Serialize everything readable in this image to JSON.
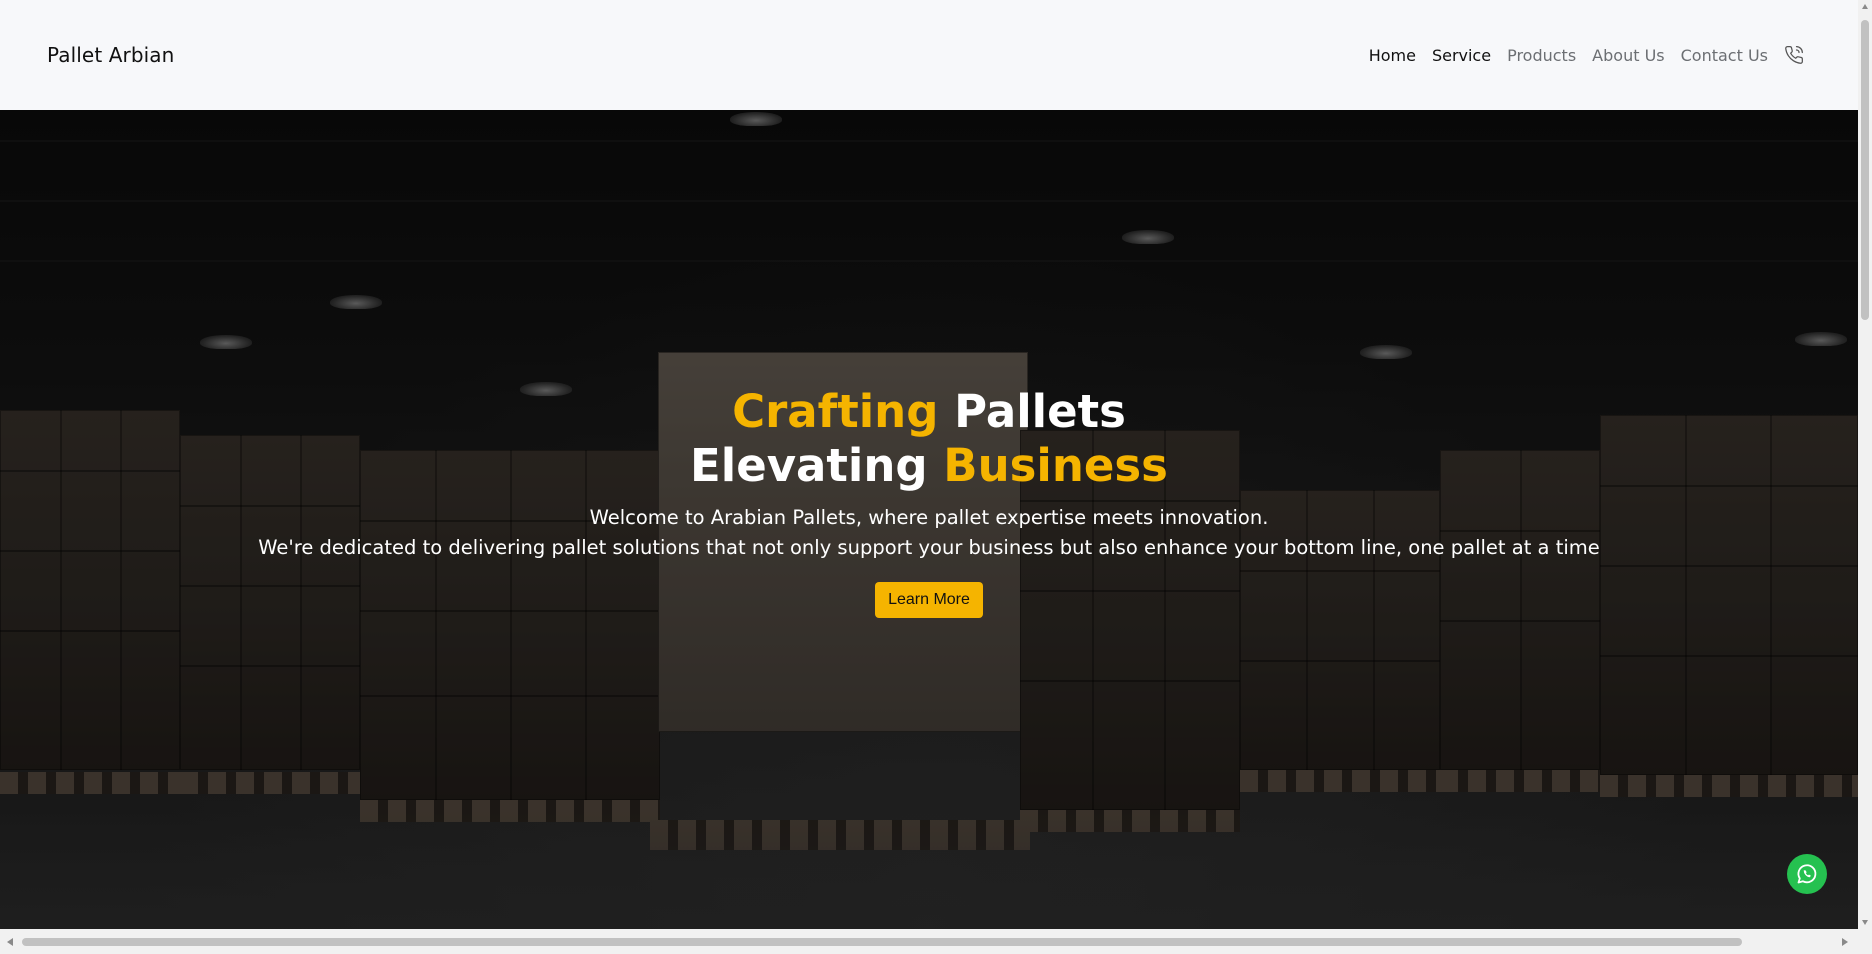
{
  "header": {
    "brand": "Pallet Arbian",
    "nav": [
      {
        "label": "Home",
        "style": "dark"
      },
      {
        "label": "Service",
        "style": "dark"
      },
      {
        "label": "Products",
        "style": "muted"
      },
      {
        "label": "About Us",
        "style": "muted"
      },
      {
        "label": "Contact Us",
        "style": "muted"
      }
    ],
    "phone_icon": "phone-icon"
  },
  "hero": {
    "headline_line1_accent": "Crafting",
    "headline_line1_rest": "Pallets",
    "headline_line2_start": "Elevating",
    "headline_line2_accent": "Business",
    "subtext_line1": "Welcome to Arabian Pallets, where pallet expertise meets innovation.",
    "subtext_line2": "We're dedicated to delivering pallet solutions that not only support your business but also enhance your bottom line, one pallet at a time",
    "cta_label": "Learn More"
  },
  "floating": {
    "whatsapp_icon": "whatsapp-icon"
  },
  "colors": {
    "accent": "#f5b400",
    "header_bg": "#f7f8fa",
    "whatsapp": "#25c150"
  }
}
